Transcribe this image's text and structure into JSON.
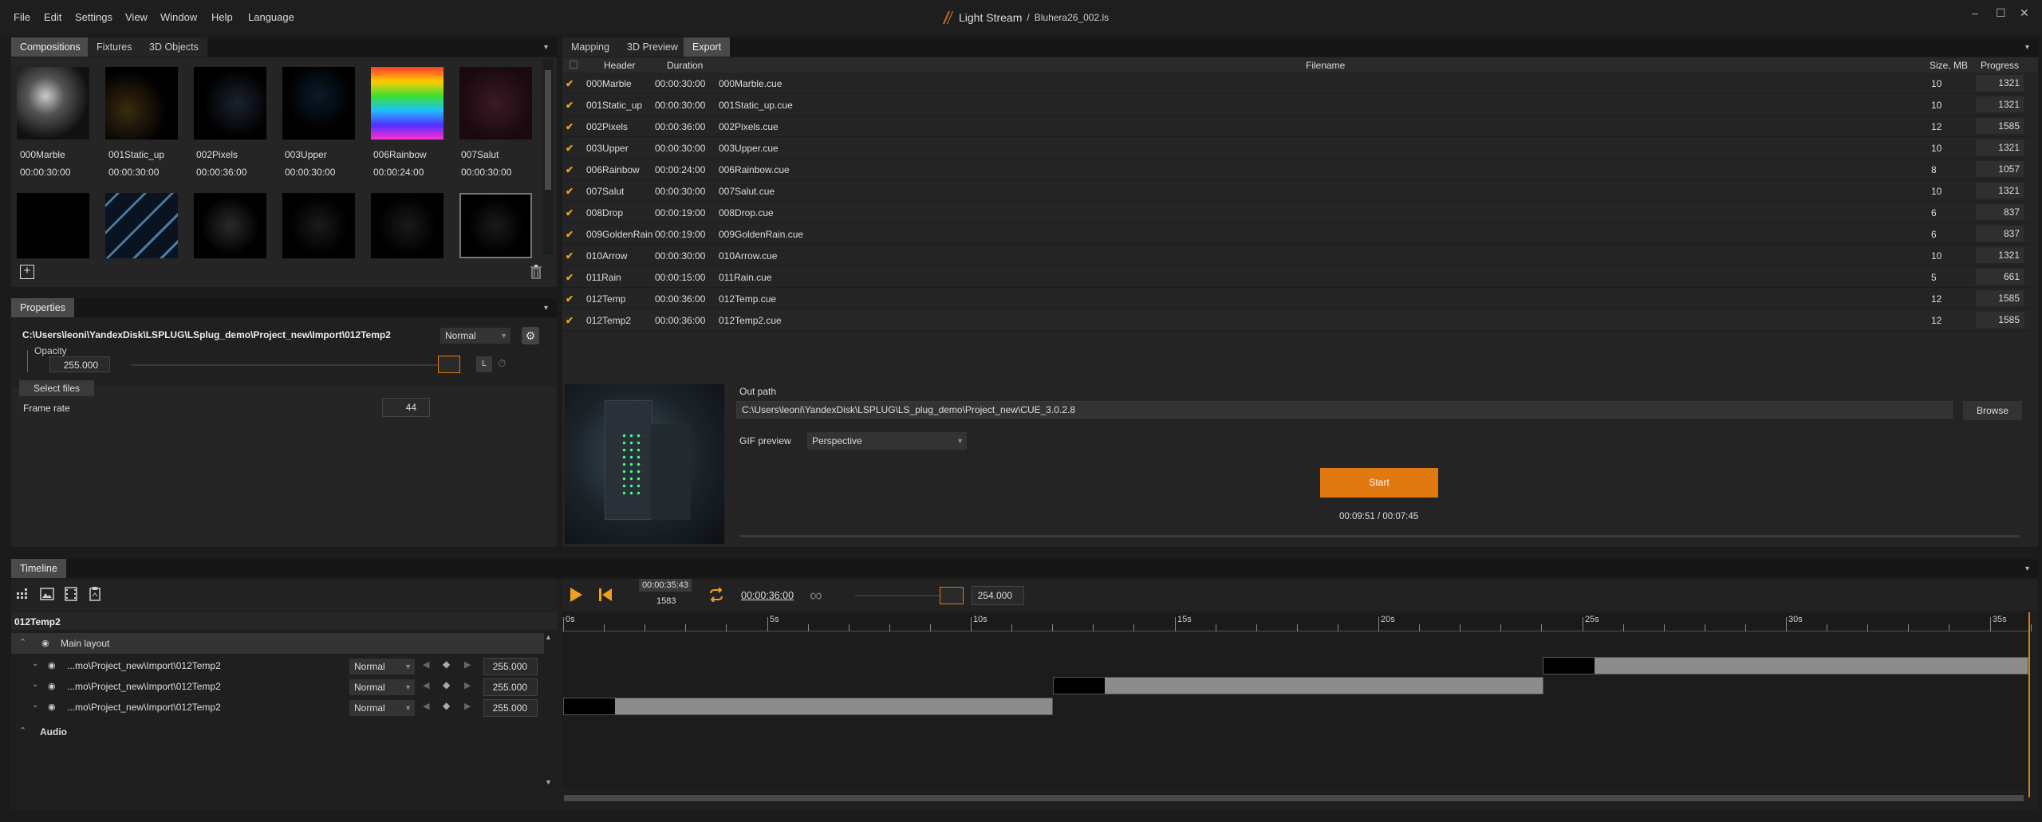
{
  "menu": [
    "File",
    "Edit",
    "Settings",
    "View",
    "Window",
    "Help",
    "Language"
  ],
  "app": {
    "name": "Light Stream",
    "separator": "/",
    "file": "Bluhera26_002.ls"
  },
  "window_controls": {
    "minimize": "–",
    "maximize": "☐",
    "close": "✕"
  },
  "left_tabs": [
    "Compositions",
    "Fixtures",
    "3D Objects"
  ],
  "compositions": [
    {
      "name": "000Marble",
      "duration": "00:00:30:00"
    },
    {
      "name": "001Static_up",
      "duration": "00:00:30:00"
    },
    {
      "name": "002Pixels",
      "duration": "00:00:36:00"
    },
    {
      "name": "003Upper",
      "duration": "00:00:30:00"
    },
    {
      "name": "006Rainbow",
      "duration": "00:00:24:00"
    },
    {
      "name": "007Salut",
      "duration": "00:00:30:00"
    }
  ],
  "properties": {
    "tab": "Properties",
    "path": "C:\\Users\\leoni\\YandexDisk\\LSPLUG\\LSplug_demo\\Project_new\\Import\\012Temp2",
    "blend": "Normal",
    "opacity_label": "Opacity",
    "opacity_value": "255.000",
    "lock_label": "L",
    "select_files": "Select files",
    "frame_rate_label": "Frame rate",
    "frame_rate_value": "44"
  },
  "right_tabs": [
    "Mapping",
    "3D Preview",
    "Export"
  ],
  "export_table": {
    "headers": {
      "header": "Header",
      "duration": "Duration",
      "filename": "Filename",
      "size": "Size, MB",
      "progress": "Progress"
    },
    "check_symbol": "✔",
    "rows": [
      {
        "header": "000Marble",
        "duration": "00:00:30:00",
        "filename": "000Marble.cue",
        "size": "10",
        "progress": "1321"
      },
      {
        "header": "001Static_up",
        "duration": "00:00:30:00",
        "filename": "001Static_up.cue",
        "size": "10",
        "progress": "1321"
      },
      {
        "header": "002Pixels",
        "duration": "00:00:36:00",
        "filename": "002Pixels.cue",
        "size": "12",
        "progress": "1585"
      },
      {
        "header": "003Upper",
        "duration": "00:00:30:00",
        "filename": "003Upper.cue",
        "size": "10",
        "progress": "1321"
      },
      {
        "header": "006Rainbow",
        "duration": "00:00:24:00",
        "filename": "006Rainbow.cue",
        "size": "8",
        "progress": "1057"
      },
      {
        "header": "007Salut",
        "duration": "00:00:30:00",
        "filename": "007Salut.cue",
        "size": "10",
        "progress": "1321"
      },
      {
        "header": "008Drop",
        "duration": "00:00:19:00",
        "filename": "008Drop.cue",
        "size": "6",
        "progress": "837"
      },
      {
        "header": "009GoldenRain",
        "duration": "00:00:19:00",
        "filename": "009GoldenRain.cue",
        "size": "6",
        "progress": "837"
      },
      {
        "header": "010Arrow",
        "duration": "00:00:30:00",
        "filename": "010Arrow.cue",
        "size": "10",
        "progress": "1321"
      },
      {
        "header": "011Rain",
        "duration": "00:00:15:00",
        "filename": "011Rain.cue",
        "size": "5",
        "progress": "661"
      },
      {
        "header": "012Temp",
        "duration": "00:00:36:00",
        "filename": "012Temp.cue",
        "size": "12",
        "progress": "1585"
      },
      {
        "header": "012Temp2",
        "duration": "00:00:36:00",
        "filename": "012Temp2.cue",
        "size": "12",
        "progress": "1585"
      }
    ]
  },
  "export": {
    "out_path_label": "Out path",
    "out_path": "C:\\Users\\leoni\\YandexDisk\\LSPLUG\\LS_plug_demo\\Project_new\\CUE_3.0.2.8",
    "browse": "Browse",
    "gif_preview_label": "GIF preview",
    "gif_preview_value": "Perspective",
    "start": "Start",
    "time": "00:09:51 / 00:07:45"
  },
  "timeline": {
    "tab": "Timeline",
    "current_time": "00:00:35:43",
    "current_frame": "1583",
    "total_time": "00:00:36:00",
    "speed": "254.000",
    "comp_name": "012Temp2",
    "main_layout": "Main layout",
    "audio": "Audio",
    "ruler": [
      "0s",
      "5s",
      "10s",
      "15s",
      "20s",
      "25s",
      "30s",
      "35s"
    ],
    "layers": [
      {
        "name": "...mo\\Project_new\\Import\\012Temp2",
        "blend": "Normal",
        "value": "255.000"
      },
      {
        "name": "...mo\\Project_new\\Import\\012Temp2",
        "blend": "Normal",
        "value": "255.000"
      },
      {
        "name": "...mo\\Project_new\\Import\\012Temp2",
        "blend": "Normal",
        "value": "255.000"
      }
    ]
  },
  "colors": {
    "accent": "#e07a10",
    "check": "#f0a020",
    "bg": "#1b1b1b",
    "panel": "#252525"
  }
}
